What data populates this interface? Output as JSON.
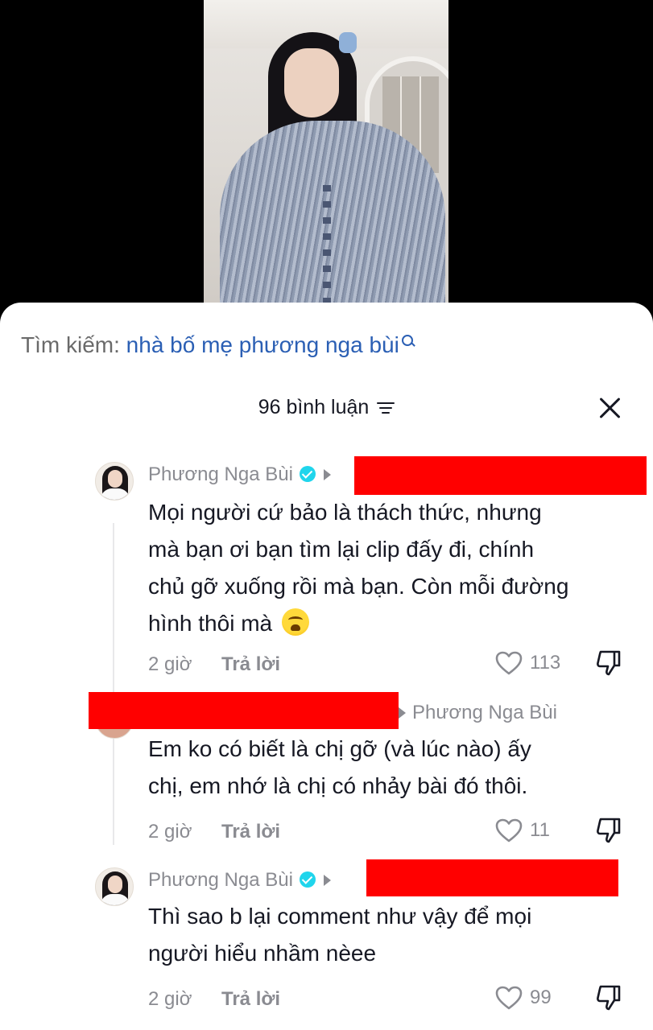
{
  "search": {
    "prefix": "Tìm kiếm: ",
    "term": "nhà bố mẹ phương nga bùi"
  },
  "header": {
    "count_label": "96 bình luận"
  },
  "comments": [
    {
      "username": "Phương Nga Bùi",
      "verified": true,
      "text_lines": [
        "Mọi người cứ bảo là thách thức, nhưng",
        "mà bạn ơi bạn tìm lại clip đấy đi, chính",
        "chủ gỡ xuống rồi mà bạn. Còn mỗi đường",
        "hình thôi mà"
      ],
      "emoji": "crying-face",
      "time": "2 giờ",
      "reply_label": "Trả lời",
      "likes": "113"
    },
    {
      "reply_to": "Phương Nga Bùi",
      "text_lines": [
        "Em ko có biết là chị gỡ (và lúc nào) ấy",
        "chị, em nhớ là chị có nhảy bài đó thôi."
      ],
      "time": "2 giờ",
      "reply_label": "Trả lời",
      "likes": "11"
    },
    {
      "username": "Phương Nga Bùi",
      "verified": true,
      "text_lines": [
        "Thì sao b lại comment như vậy để mọi",
        "người hiểu nhầm nèee"
      ],
      "time": "2 giờ",
      "reply_label": "Trả lời",
      "likes": "99"
    }
  ],
  "colors": {
    "accent_link": "#2b5fb4",
    "redaction": "#ff0000",
    "muted_text": "#8a8b91",
    "verified_badge": "#20d5ec"
  }
}
